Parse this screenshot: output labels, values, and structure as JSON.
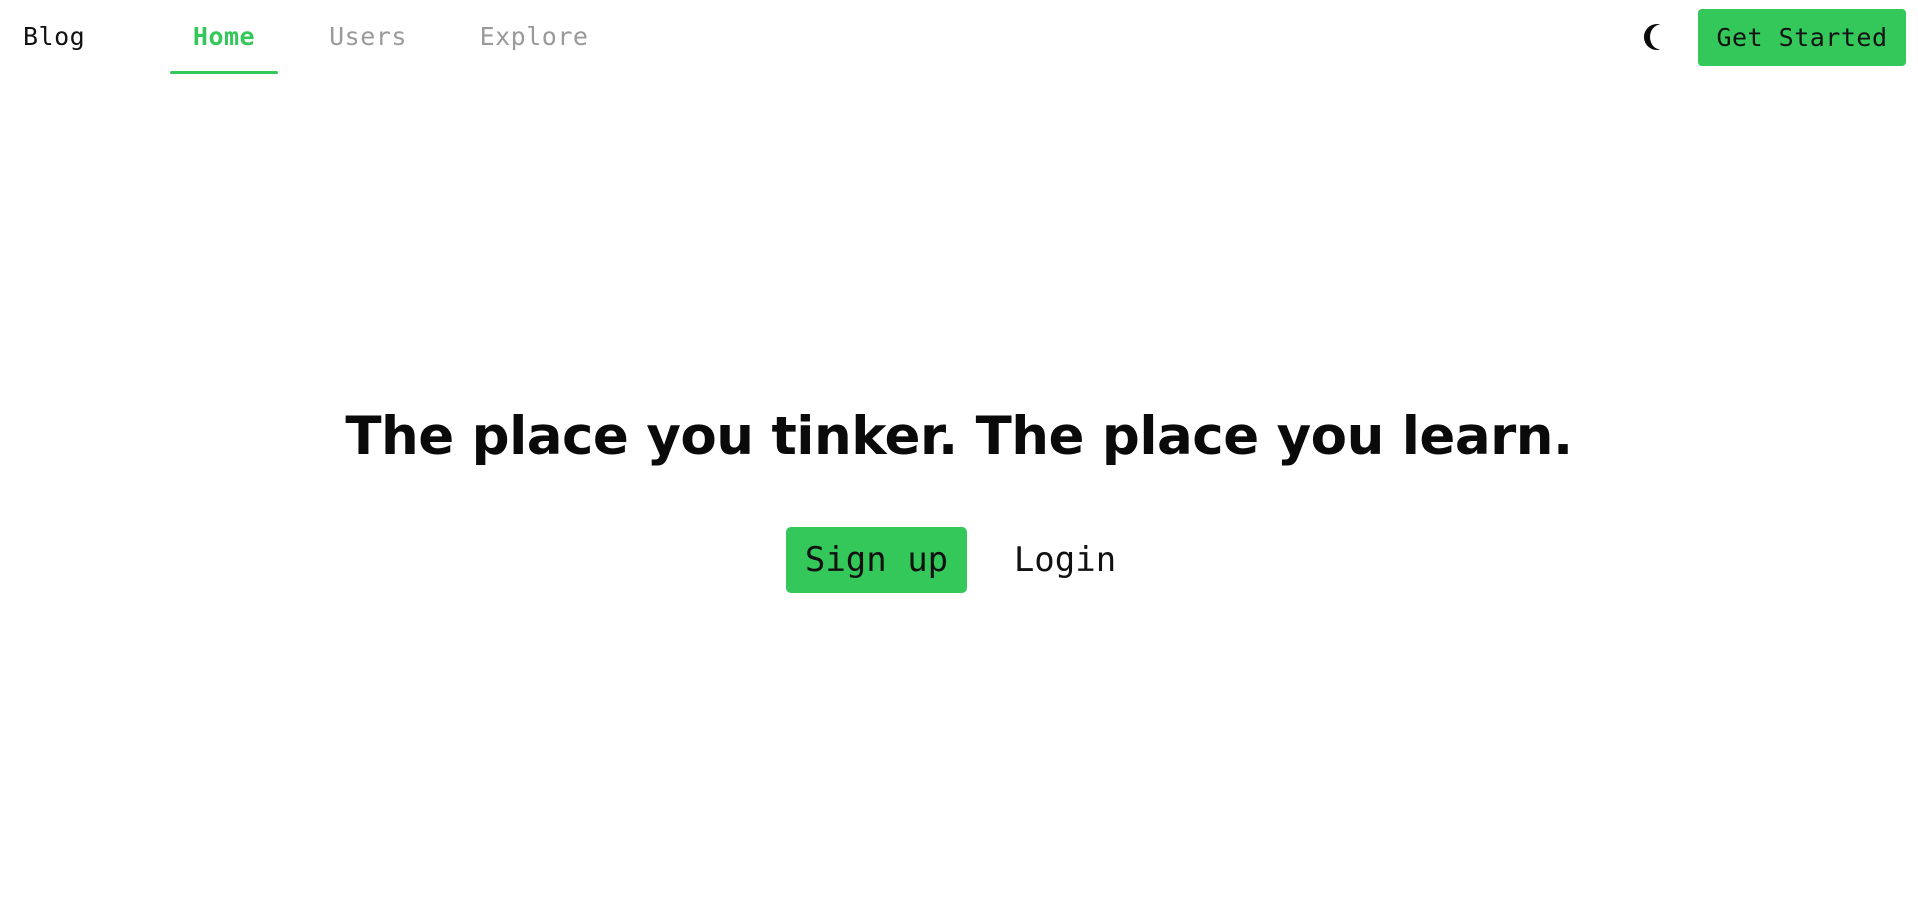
{
  "header": {
    "brand": "Blog",
    "tabs": [
      {
        "label": "Home",
        "active": true
      },
      {
        "label": "Users",
        "active": false
      },
      {
        "label": "Explore",
        "active": false
      }
    ],
    "theme_toggle_icon": "moon-icon",
    "cta_label": "Get Started"
  },
  "hero": {
    "title": "The place you tinker. The place you learn.",
    "signup_label": "Sign up",
    "login_label": "Login"
  },
  "colors": {
    "accent": "#34c759",
    "text": "#111111",
    "muted": "#9a9a9a",
    "background": "#ffffff"
  }
}
